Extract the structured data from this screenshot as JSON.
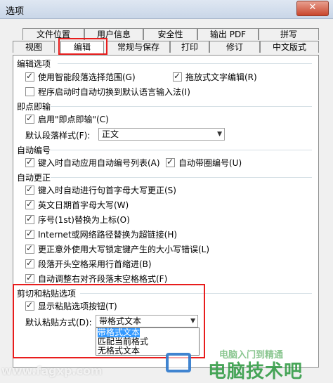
{
  "window": {
    "title": "选项"
  },
  "tabs_top": [
    "文件位置",
    "用户信息",
    "安全性",
    "输出 PDF",
    "拼写"
  ],
  "tabs_bottom": [
    "视图",
    "编辑",
    "常规与保存",
    "打印",
    "修订",
    "中文版式"
  ],
  "active_tab": "编辑",
  "groups": {
    "edit": "编辑选项",
    "clickinput": "即点即输",
    "autonum": "自动编号",
    "autocorrect": "自动更正",
    "cutpaste": "剪切和粘贴选项"
  },
  "edit_options": {
    "smart_select": "使用智能段落选择范围(G)",
    "drag_drop": "拖放式文字编辑(R)",
    "auto_ime": "程序启动时自动切换到默认语言输入法(I)"
  },
  "click_input": {
    "enable": "启用\"即点即输\"(C)",
    "default_style_label": "默认段落样式(F):",
    "default_style_value": "正文"
  },
  "auto_number": {
    "auto_list": "键入时自动应用自动编号列表(A)",
    "circle_num": "自动带圈编号(U)"
  },
  "auto_correct": [
    "键入时自动进行句首字母大写更正(S)",
    "英文日期首字母大写(W)",
    "序号(1st)替换为上标(O)",
    "Internet或网络路径替换为超链接(H)",
    "更正意外使用大写锁定键产生的大小写错误(L)",
    "段落开头空格采用行首缩进(B)",
    "自动调整右对齐段落末空格格式(F)"
  ],
  "cut_paste": {
    "show_button": "显示粘贴选项按钮(T)",
    "default_paste_label": "默认粘贴方式(D):",
    "default_paste_value": "带格式文本",
    "options": [
      "带格式文本",
      "匹配当前格式",
      "无格式文本"
    ]
  },
  "watermark": {
    "left": "www.fagxp.com",
    "right": "电脑技术吧",
    "small": "电脑入门到精通"
  }
}
